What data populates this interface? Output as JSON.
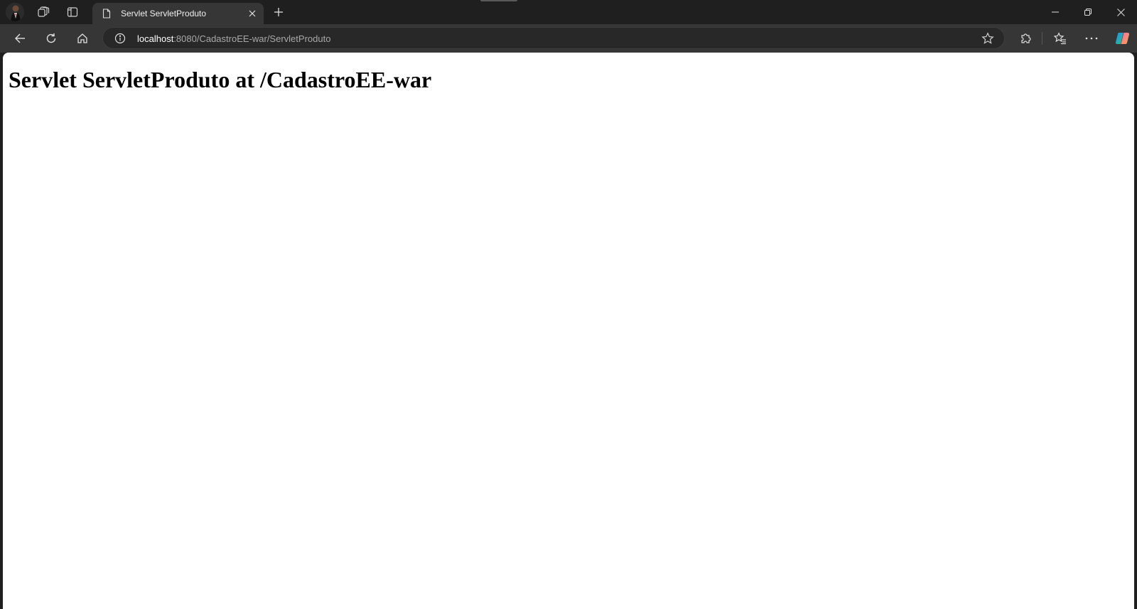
{
  "browser": {
    "tab": {
      "title": "Servlet ServletProduto"
    },
    "address_bar": {
      "host": "localhost",
      "rest": ":8080/CadastroEE-war/ServletProduto"
    },
    "icons": {
      "workspaces": "workspaces-icon",
      "vertical_tabs": "vertical-tabs-icon",
      "new_tab": "plus-icon",
      "back": "back-arrow-icon",
      "refresh": "refresh-icon",
      "home": "home-icon",
      "site_info": "info-icon",
      "favorite": "star-icon",
      "extensions": "extensions-icon",
      "favorites": "favorites-icon",
      "more": "more-icon",
      "copilot": "copilot-icon"
    },
    "colors": {
      "chrome_dark": "#1f1f1f",
      "toolbar": "#363636",
      "page": "#ffffff"
    }
  },
  "page": {
    "heading": "Servlet ServletProduto at /CadastroEE-war"
  }
}
